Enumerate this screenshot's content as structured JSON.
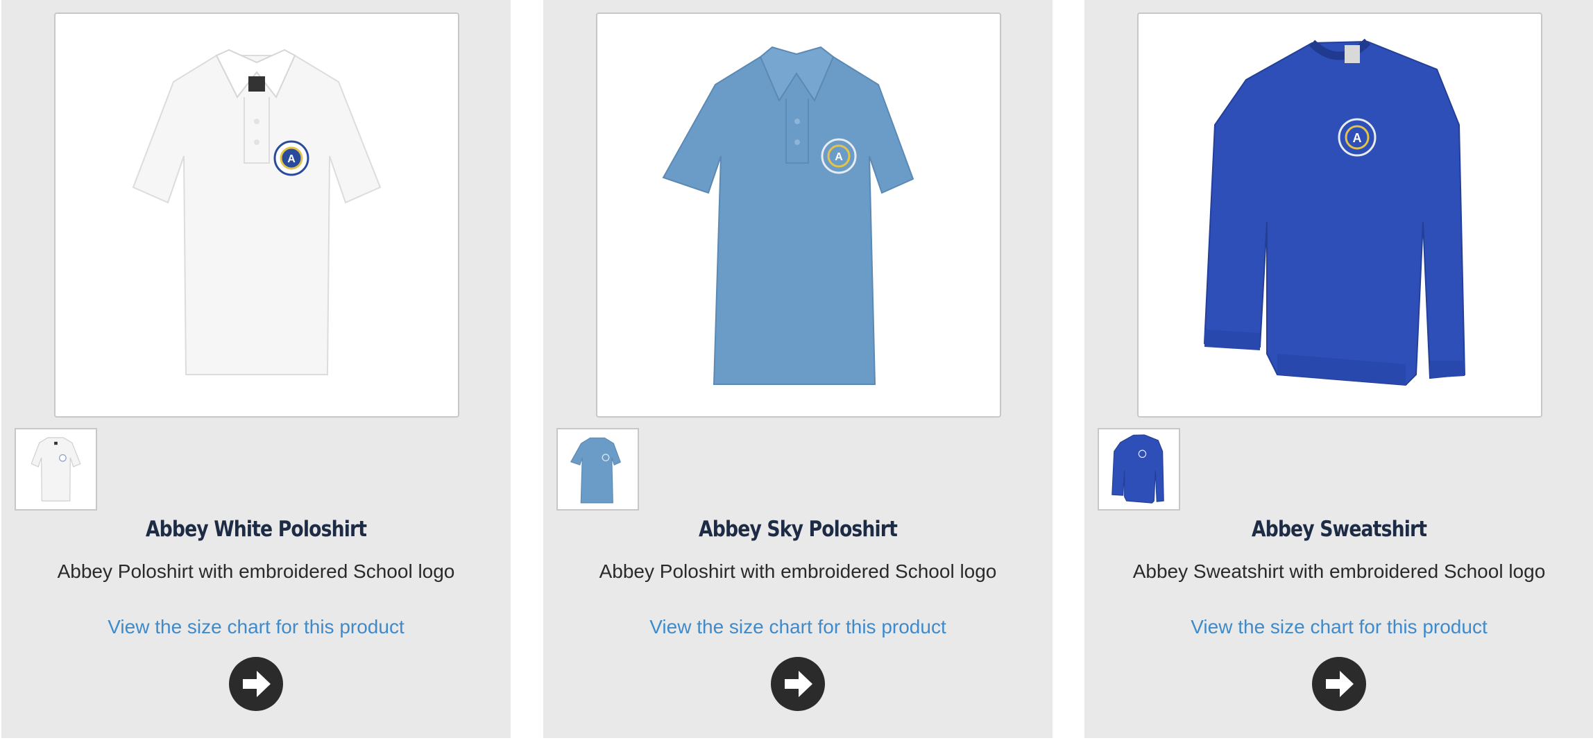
{
  "products": [
    {
      "name": "Abbey White Poloshirt",
      "description": "Abbey Poloshirt with embroidered School logo",
      "size_link": "View the size chart for this product",
      "garment_color": "#f6f6f6",
      "garment_type": "poloshirt",
      "image_icon": "white-poloshirt-image",
      "go_icon": "arrow-right-icon"
    },
    {
      "name": "Abbey Sky Poloshirt",
      "description": "Abbey Poloshirt with embroidered School logo",
      "size_link": "View the size chart for this product",
      "garment_color": "#6b9cc8",
      "garment_type": "poloshirt",
      "image_icon": "sky-poloshirt-image",
      "go_icon": "arrow-right-icon"
    },
    {
      "name": "Abbey Sweatshirt",
      "description": "Abbey Sweatshirt with embroidered School logo",
      "size_link": "View the size chart for this product",
      "garment_color": "#2e4fb8",
      "garment_type": "sweatshirt",
      "image_icon": "royal-blue-sweatshirt-image",
      "go_icon": "arrow-right-icon"
    }
  ],
  "colors": {
    "card_background": "#e9e9e9",
    "title": "#1d2b45",
    "link": "#3f8acb",
    "button": "#2b2b2b"
  }
}
